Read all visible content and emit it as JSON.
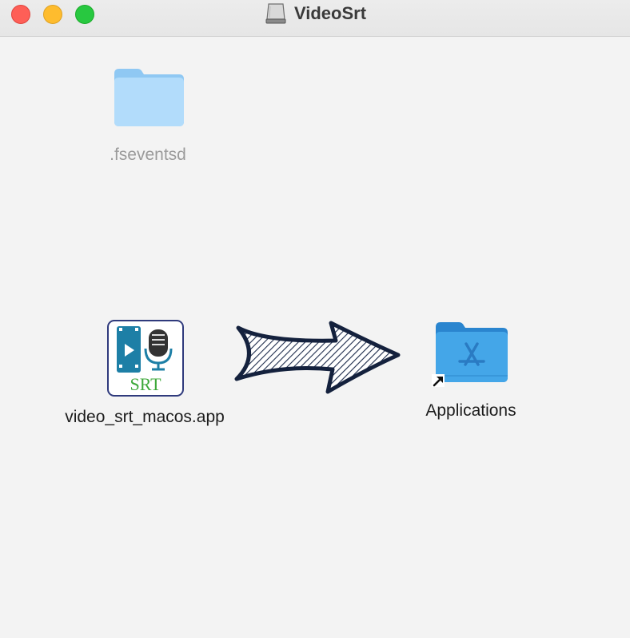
{
  "window": {
    "title": "VideoSrt",
    "title_icon": "disk-image-icon",
    "traffic_lights": {
      "close": "#fe5f57",
      "minimize": "#febc2e",
      "maximize": "#28c840"
    }
  },
  "items": {
    "fseventsd": {
      "label": ".fseventsd",
      "icon": "folder-icon"
    },
    "app": {
      "label": "video_srt_macos.app",
      "icon": "app-icon",
      "icon_text": "SRT"
    },
    "applications": {
      "label": "Applications",
      "icon": "applications-folder-alias-icon"
    }
  },
  "decor": {
    "arrow": "drag-arrow-icon"
  }
}
